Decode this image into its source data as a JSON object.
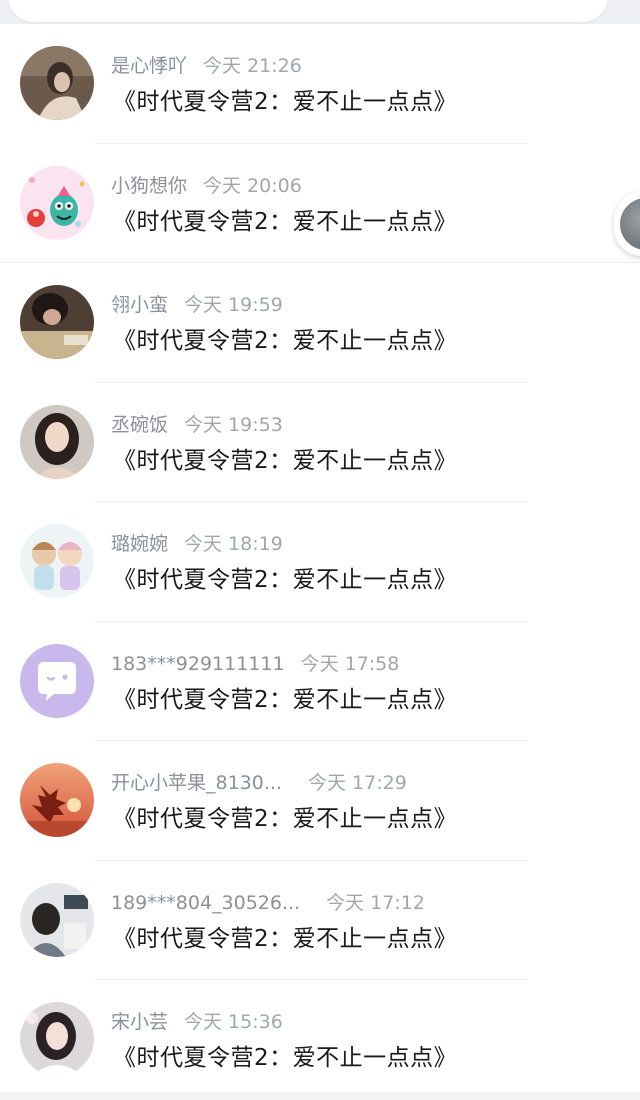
{
  "messages": [
    {
      "username": "是心悸吖",
      "time": "今天 21:26",
      "text": "《时代夏令营2：爱不止一点点》",
      "avatar": "avatar-photo"
    },
    {
      "username": "小狗想你",
      "time": "今天 20:06",
      "text": "《时代夏令营2：爱不止一点点》",
      "avatar": "avatar-cartoon"
    },
    {
      "username": "翎小蛮",
      "time": "今天 19:59",
      "text": "《时代夏令营2：爱不止一点点》",
      "avatar": "avatar-photo"
    },
    {
      "username": "丞碗饭",
      "time": "今天 19:53",
      "text": "《时代夏令营2：爱不止一点点》",
      "avatar": "avatar-photo"
    },
    {
      "username": "璐婉婉",
      "time": "今天 18:19",
      "text": "《时代夏令营2：爱不止一点点》",
      "avatar": "avatar-cartoon"
    },
    {
      "username": "183***929111111",
      "time": "今天 17:58",
      "text": "《时代夏令营2：爱不止一点点》",
      "avatar": "default-chat-avatar"
    },
    {
      "username": "开心小苹果_8130...",
      "time": "今天 17:29",
      "text": "《时代夏令营2：爱不止一点点》",
      "avatar": "avatar-sunset"
    },
    {
      "username": "189***804_30526...",
      "time": "今天 17:12",
      "text": "《时代夏令营2：爱不止一点点》",
      "avatar": "avatar-photo"
    },
    {
      "username": "宋小芸",
      "time": "今天 15:36",
      "text": "《时代夏令营2：爱不止一点点》",
      "avatar": "avatar-photo"
    }
  ],
  "colors": {
    "username": "#8c9098",
    "time": "#a2a6ad",
    "message": "#1a1a1a",
    "default_avatar_bg": "#c9b8ec"
  }
}
